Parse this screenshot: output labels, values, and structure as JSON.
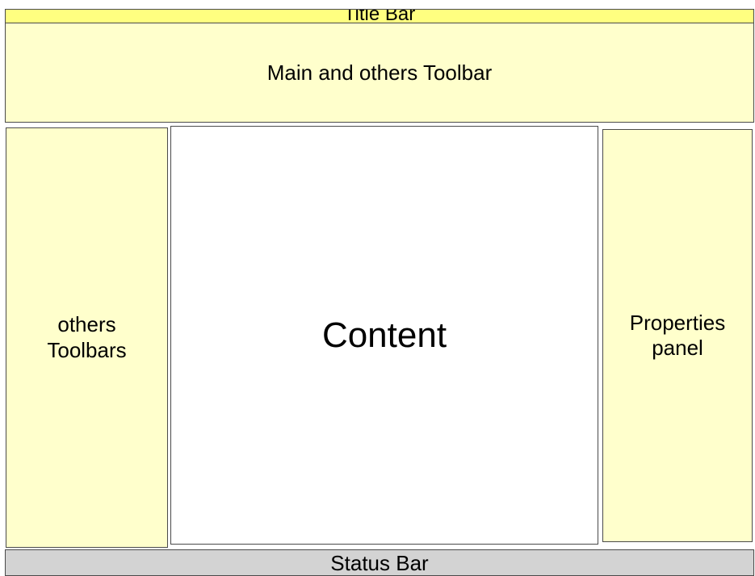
{
  "layout": {
    "title_bar": "Title Bar",
    "main_toolbar": "Main and others Toolbar",
    "left_toolbars": "others\nToolbars",
    "content": "Content",
    "properties_panel": "Properties\npanel",
    "status_bar": "Status Bar"
  },
  "colors": {
    "title_bar": "#ffff80",
    "panel": "#ffffcc",
    "content": "#ffffff",
    "status_bar": "#d3d3d3"
  }
}
